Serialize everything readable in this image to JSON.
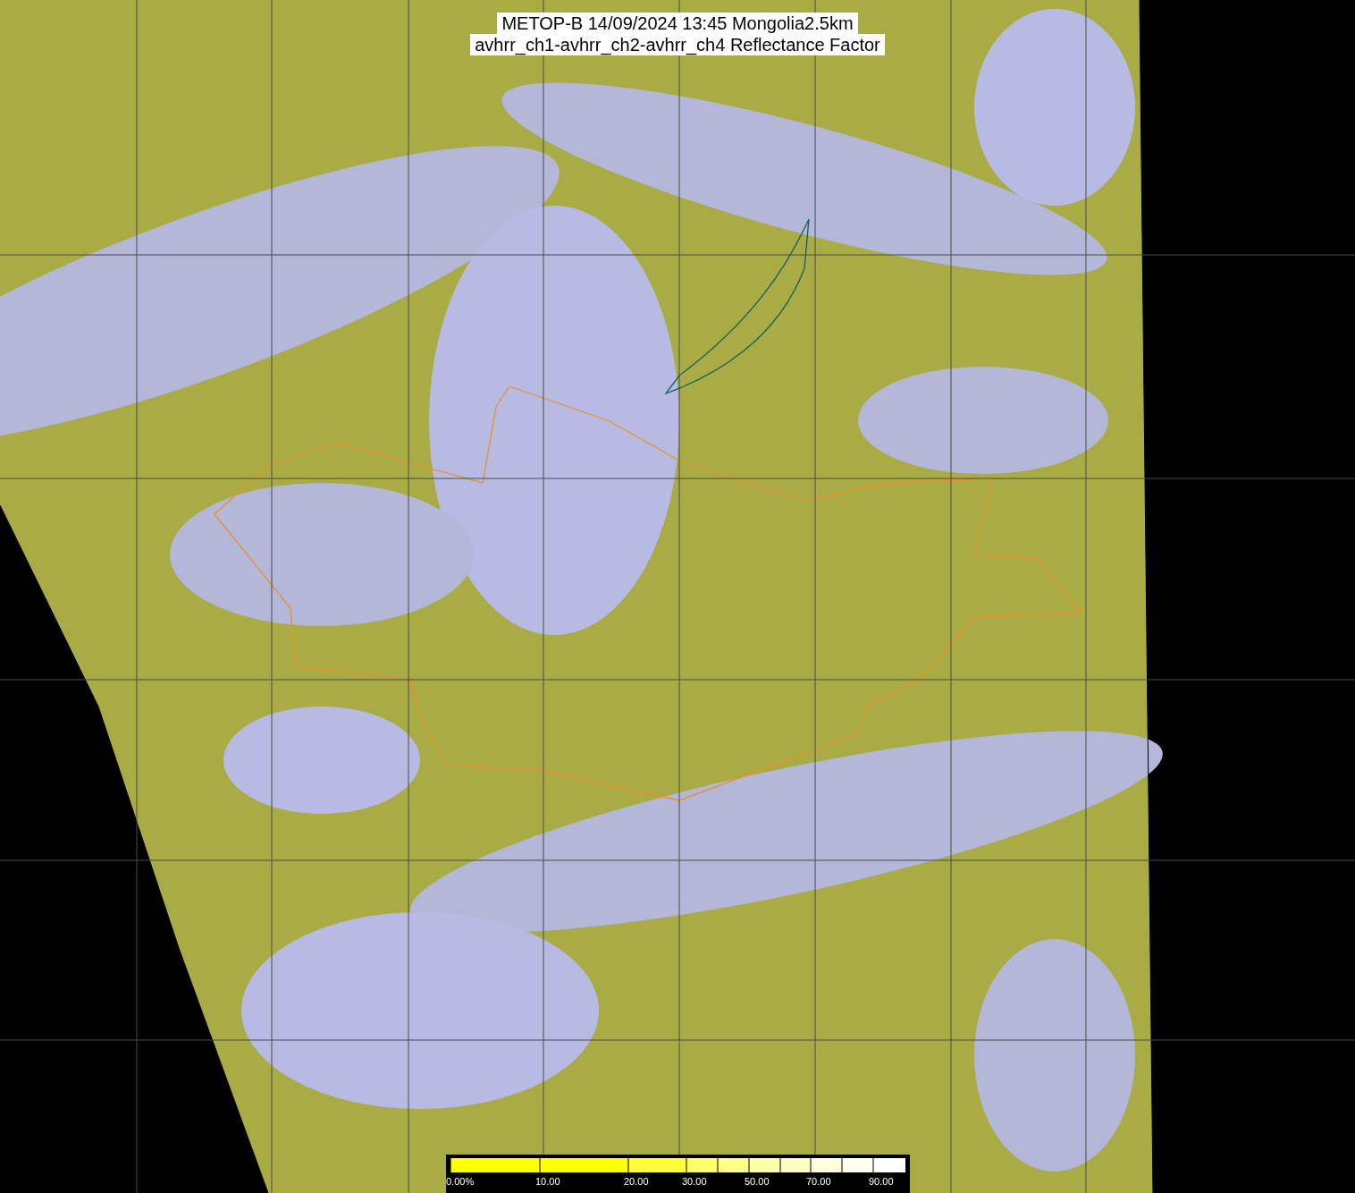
{
  "title": {
    "lines": [
      "METOP-B 14/09/2024 13:45 Mongolia2.5km",
      "avhrr_ch1-avhrr_ch2-avhrr_ch4 Reflectance Factor"
    ]
  },
  "colorbar": {
    "labels": [
      "0.00%",
      "10.00",
      "20.00",
      "30.00",
      "50.00",
      "70.00",
      "90.00"
    ]
  }
}
